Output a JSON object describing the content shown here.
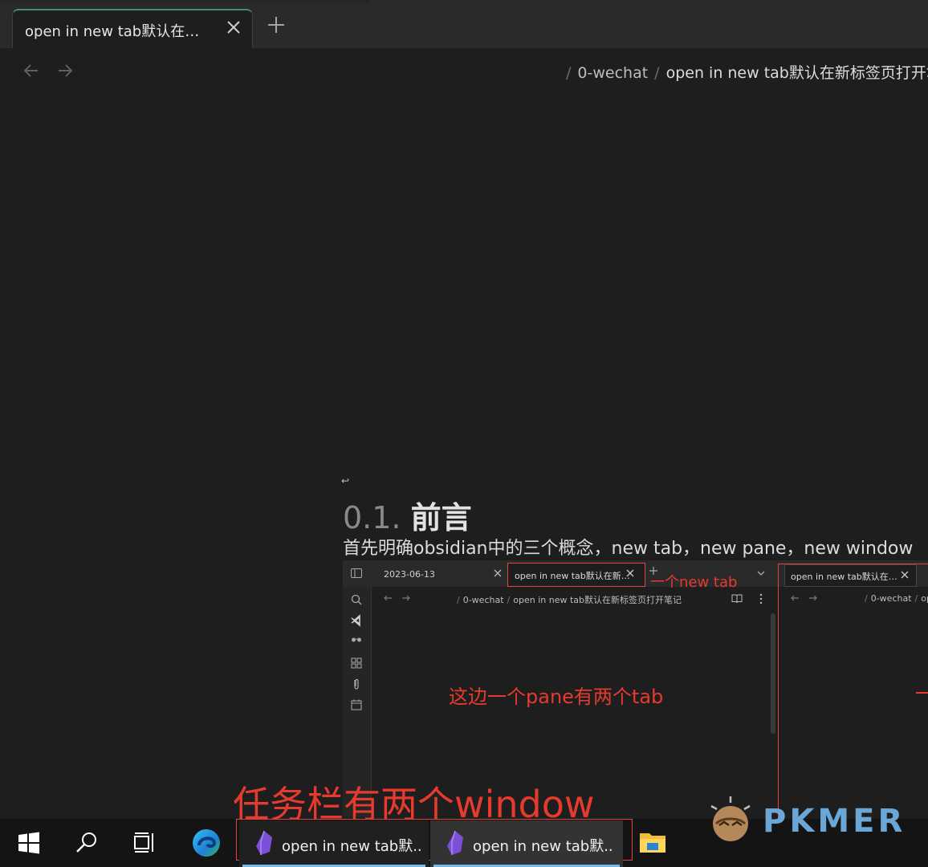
{
  "app": {
    "tab_title": "open in new tab默认在…",
    "breadcrumb": {
      "folder": "0-wechat",
      "current": "open in new tab默认在新标签页打开笔"
    }
  },
  "content": {
    "small_mark": "↩",
    "heading_number": "0.1.",
    "heading_text": "前言",
    "intro": "首先明确obsidian中的三个概念，new tab，new pane，new window"
  },
  "embedded": {
    "tab1_title": "2023-06-13",
    "tab2_title": "open in new tab默认在新…",
    "breadcrumb_folder": "0-wechat",
    "breadcrumb_current": "open in new tab默认在新标签页打开笔记",
    "right_tab_title": "open in new tab默认在…",
    "right_breadcrumb_folder": "0-wechat",
    "right_breadcrumb_current": "ope"
  },
  "annotations": {
    "new_tab": "一个new tab",
    "pane": "这边一个pane有两个tab",
    "taskbar": "任务栏有两个window"
  },
  "taskbar": {
    "apps": [
      {
        "label": "open in new tab默..."
      },
      {
        "label": "open in new tab默..."
      }
    ]
  },
  "logo": {
    "text": "PKMER"
  },
  "colors": {
    "background": "#1e1e1e",
    "annotation": "#e63a2e",
    "accent": "#3f8d7f",
    "taskbar_active": "#76b9ed",
    "obsidian": "#7c4fd8",
    "logo": "#6aa6d6"
  }
}
